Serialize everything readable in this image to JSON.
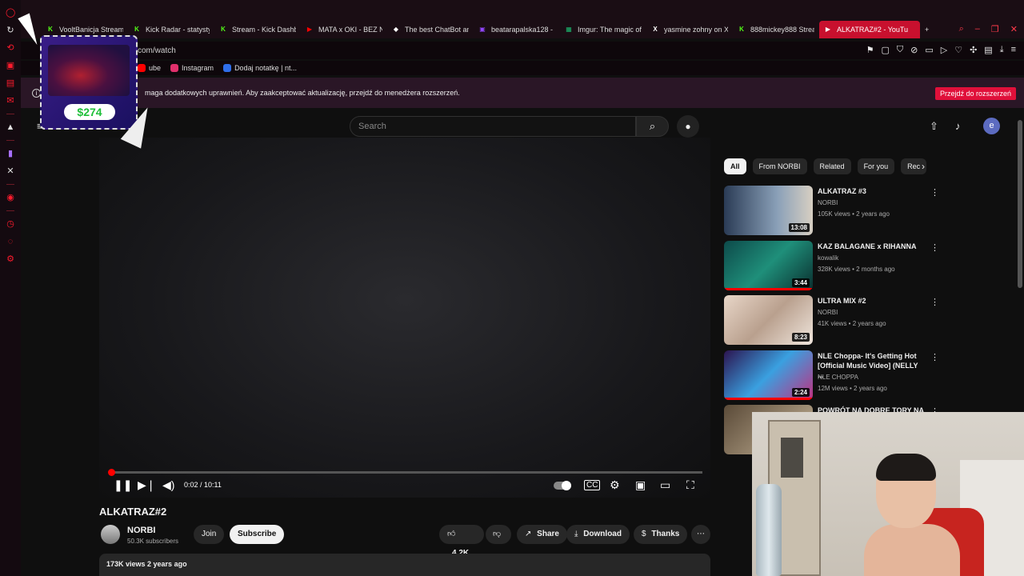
{
  "browser": {
    "tabs": [
      {
        "label": "VooltBanicja Stream",
        "fav": "K",
        "fav_color": "#53fc18"
      },
      {
        "label": "Kick Radar - statysty",
        "fav": "K",
        "fav_color": "#53fc18"
      },
      {
        "label": "Stream - Kick Dashb",
        "fav": "K",
        "fav_color": "#53fc18"
      },
      {
        "label": "MATA x OKI - BEZ N",
        "fav": "▶",
        "fav_color": "#ff0000"
      },
      {
        "label": "The best ChatBot an",
        "fav": "◆",
        "fav_color": "#ffffff"
      },
      {
        "label": "beatarapalska128 -",
        "fav": "▣",
        "fav_color": "#9146ff"
      },
      {
        "label": "Imgur: The magic of",
        "fav": "▦",
        "fav_color": "#1bb76e"
      },
      {
        "label": "yasmine zohny on X",
        "fav": "X",
        "fav_color": "#ffffff"
      },
      {
        "label": "888mickey888 Strea",
        "fav": "K",
        "fav_color": "#53fc18"
      },
      {
        "label": "ALKATRAZ#2 - YouTu",
        "fav": "▶",
        "fav_color": "#ffffff",
        "active": true
      }
    ],
    "new_tab": "+",
    "url": "com/watch",
    "bookmarks": [
      {
        "label": "ube",
        "icon_color": "#ff0000"
      },
      {
        "label": "Instagram",
        "icon_color": "#e1306c"
      },
      {
        "label": "Dodaj notatkę | nt...",
        "icon_color": "#2f6fea"
      }
    ],
    "notice": {
      "message": "maga dodatkowych uprawnień. Aby zaakceptować aktualizację, przejdź do menedżera rozszerzeń.",
      "button": "Przejdź do rozszerzeń"
    }
  },
  "overlay": {
    "amount": "$274"
  },
  "youtube": {
    "search_placeholder": "Search",
    "avatar_letter": "e",
    "player": {
      "time": "0:02 / 10:11",
      "progress_percent": 0.3
    },
    "video": {
      "title": "ALKATRAZ#2",
      "channel": "NORBI",
      "subscribers": "50.3K subscribers",
      "join": "Join",
      "subscribe": "Subscribe",
      "likes": "4.2K",
      "share": "Share",
      "download": "Download",
      "thanks": "Thanks",
      "views_date": "173K views  2 years ago"
    },
    "chips": [
      "All",
      "From NORBI",
      "Related",
      "For you",
      "Rec"
    ],
    "recommendations": [
      {
        "title": "ALKATRAZ #3",
        "channel": "NORBI",
        "meta": "105K views • 2 years ago",
        "duration": "13:08",
        "thumb": "linear-gradient(90deg,#2a3b55,#8aa0b8 60%,#d7cfc2)",
        "progress": false
      },
      {
        "title": "KAZ BALAGANE x RIHANNA",
        "channel": "kowalik",
        "meta": "328K views • 2 months ago",
        "duration": "3:44",
        "thumb": "linear-gradient(135deg,#0d4a4a,#1f8f7a 50%,#0a2e2e)",
        "progress": true
      },
      {
        "title": "ULTRA MIX #2",
        "channel": "NORBI",
        "meta": "41K views • 2 years ago",
        "duration": "8:23",
        "thumb": "linear-gradient(135deg,#e8d6c8,#b9a08e 50%,#f0e6dd)",
        "progress": false
      },
      {
        "title": "NLE Choppa- It's Getting Hot [Official Music Video] (NELLY ...",
        "channel": "NLE CHOPPA",
        "meta": "12M views • 2 years ago",
        "duration": "2:24",
        "thumb": "linear-gradient(135deg,#2c1450,#3aa0e0 50%,#c03080)",
        "progress": true
      },
      {
        "title": "POWRÓT NA DOBRE TORY NA",
        "channel": "",
        "meta": "",
        "duration": "",
        "thumb": "linear-gradient(135deg,#5a4a38,#c9b79a)",
        "progress": false
      }
    ]
  }
}
